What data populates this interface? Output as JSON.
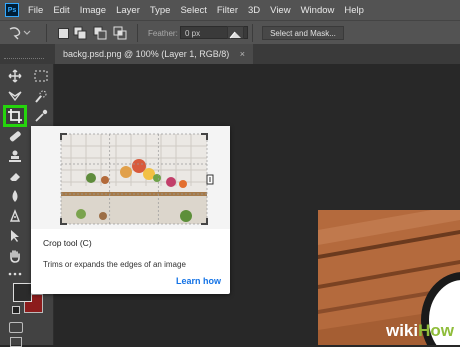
{
  "app": {
    "logo_text": "Ps"
  },
  "menu": [
    "File",
    "Edit",
    "Image",
    "Layer",
    "Type",
    "Select",
    "Filter",
    "3D",
    "View",
    "Window",
    "Help"
  ],
  "options_bar": {
    "feather_label": "Feather:",
    "feather_value": "0 px",
    "select_mask_label": "Select and Mask..."
  },
  "document_tab": {
    "title": "backg.psd.png @ 100% (Layer 1, RGB/8)",
    "close_glyph": "×"
  },
  "tools": [
    {
      "name": "move-tool",
      "icon": "move-icon"
    },
    {
      "name": "marquee-tool",
      "icon": "marquee-icon"
    },
    {
      "name": "lasso-tool",
      "icon": "lasso-icon"
    },
    {
      "name": "quick-select-tool",
      "icon": "quick-select-icon"
    },
    {
      "name": "crop-tool",
      "icon": "crop-icon",
      "selected": true
    },
    {
      "name": "eyedropper-tool",
      "icon": "eyedropper-icon"
    },
    {
      "name": "healing-tool",
      "icon": "bandage-icon"
    },
    {
      "name": "stamp-tool",
      "icon": "stamp-icon"
    },
    {
      "name": "eraser-tool",
      "icon": "eraser-icon"
    },
    {
      "name": "blur-tool",
      "icon": "drop-icon"
    },
    {
      "name": "pen-tool",
      "icon": "pen-icon"
    },
    {
      "name": "path-select-tool",
      "icon": "arrow-icon"
    },
    {
      "name": "hand-tool",
      "icon": "hand-icon"
    },
    {
      "name": "more-tools",
      "icon": "ellipsis-icon"
    }
  ],
  "colors": {
    "accent_highlight": "#25d40c",
    "foreground": "#2b2b2b",
    "background": "#8c1c1c",
    "link": "#1473e6"
  },
  "tooltip": {
    "title": "Crop tool (C)",
    "description": "Trims or expands the edges of an image",
    "link_label": "Learn how"
  },
  "watermark": {
    "part1": "wiki",
    "part2": "How"
  }
}
